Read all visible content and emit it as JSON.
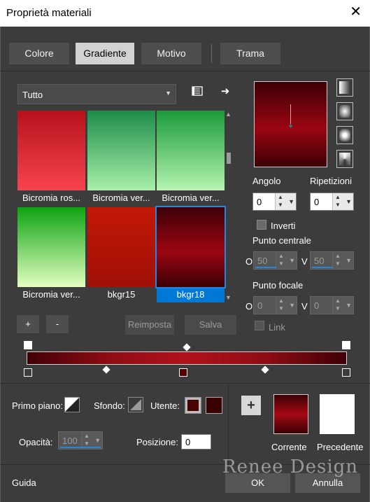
{
  "window": {
    "title": "Proprietà materiali",
    "close_glyph": "✕"
  },
  "tabs": [
    {
      "label": "Colore",
      "active": false
    },
    {
      "label": "Gradiente",
      "active": true
    },
    {
      "label": "Motivo",
      "active": false
    },
    {
      "label": "Trama",
      "active": false
    }
  ],
  "library": {
    "category": "Tutto",
    "items": [
      {
        "label": "Bicromia ros...",
        "gradient": [
          "#b5121b",
          "#f7444f"
        ]
      },
      {
        "label": "Bicromia ver...",
        "gradient": [
          "#1e8c4a",
          "#a8f0a8"
        ]
      },
      {
        "label": "Bicromia ver...",
        "gradient": [
          "#1a9a3a",
          "#b6f5b0"
        ]
      },
      {
        "label": "Bicromia ver...",
        "gradient": [
          "#0ea312",
          "#e2ffc0"
        ]
      },
      {
        "label": "bkgr15",
        "gradient": [
          "#c21806",
          "#a01006"
        ]
      },
      {
        "label": "bkgr18",
        "gradient": [
          "#3c0005",
          "#9a0612"
        ],
        "selected": true
      }
    ]
  },
  "list_buttons": {
    "add": "+",
    "remove": "-",
    "reset": "Reimposta",
    "save": "Salva"
  },
  "gradient_settings": {
    "angolo_label": "Angolo",
    "angolo": "0",
    "ripetizioni_label": "Ripetizioni",
    "ripetizioni": "0",
    "inverti_label": "Inverti",
    "punto_centrale_label": "Punto centrale",
    "centro_o_label": "O",
    "centro_o": "50",
    "centro_v_label": "V",
    "centro_v": "50",
    "punto_focale_label": "Punto focale",
    "focale_o_label": "O",
    "focale_o": "0",
    "focale_v_label": "V",
    "focale_v": "0",
    "link_label": "Link"
  },
  "material": {
    "primo_piano_label": "Primo piano:",
    "sfondo_label": "Sfondo:",
    "utente_label": "Utente:",
    "opacita_label": "Opacità:",
    "opacita": "100",
    "posizione_label": "Posizione:",
    "posizione": "0",
    "user_colors": [
      "#4a0000",
      "#3a0000"
    ]
  },
  "comparison": {
    "add_glyph": "+",
    "corrente_label": "Corrente",
    "precedente_label": "Precedente"
  },
  "footer": {
    "guida": "Guida",
    "ok": "OK",
    "annulla": "Annulla",
    "watermark": "Renee Design"
  },
  "colors": {
    "accent": "#0078d7",
    "dialog_bg": "#3c3c3c"
  }
}
